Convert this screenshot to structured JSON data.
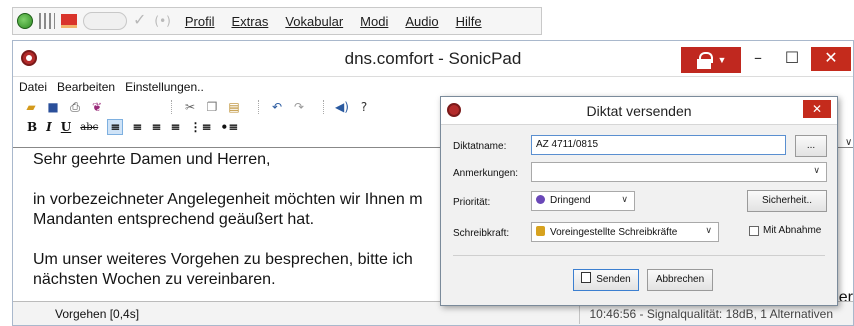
{
  "topbar": {
    "menu": [
      "Profil",
      "Extras",
      "Vokabular",
      "Modi",
      "Audio",
      "Hilfe"
    ]
  },
  "window": {
    "title": "dns.comfort - SonicPad",
    "menu": [
      "Datei",
      "Bearbeiten",
      "Einstellungen.."
    ],
    "status_left": "Vorgehen [0,4s]",
    "status_right": "10:46:56 - Signalqualität: 18dB, 1 Alternativen"
  },
  "editor": {
    "line1": "Sehr geehrte Damen und Herren,",
    "para2_line1": "in vorbezeichneter Angelegenheit möchten wir Ihnen m",
    "para2_line2": "Mandanten entsprechend geäußert hat.",
    "para3_line1": "Um unser weiteres Vorgehen zu besprechen, bitte ich",
    "para3_line2": "nächsten Wochen zu vereinbaren.",
    "edge_char": "er"
  },
  "dialog": {
    "title": "Diktat versenden",
    "name_label": "Diktatname:",
    "name_value": "AZ 4711/0815",
    "browse_label": "...",
    "notes_label": "Anmerkungen:",
    "notes_value": "",
    "priority_label": "Priorität:",
    "priority_value": "Dringend",
    "security_button": "Sicherheit..",
    "typist_label": "Schreibkraft:",
    "typist_value": "Voreingestellte Schreibkräfte",
    "abnahme_label": "Mit Abnahme",
    "send_button": "Senden",
    "cancel_button": "Abbrechen"
  },
  "colors": {
    "accent_red": "#c42b1c",
    "lock_red": "#c0281f",
    "selection_blue": "#cfe3f7"
  }
}
